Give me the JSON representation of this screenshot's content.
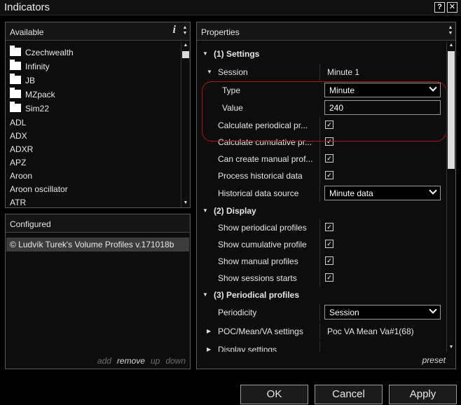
{
  "window": {
    "title": "Indicators",
    "help_button": "?",
    "close_button": "✕"
  },
  "available": {
    "title": "Available",
    "info_icon": "i",
    "folders": [
      "Czechwealth",
      "Infinity",
      "JB",
      "MZpack",
      "Sim22"
    ],
    "indicators": [
      "ADL",
      "ADX",
      "ADXR",
      "APZ",
      "Aroon",
      "Aroon oscillator",
      "ATR"
    ]
  },
  "configured": {
    "title": "Configured",
    "items": [
      "© Ludvík Turek's Volume Profiles v.171018b"
    ],
    "actions": {
      "add": "add",
      "remove": "remove",
      "up": "up",
      "down": "down"
    }
  },
  "properties": {
    "title": "Properties",
    "preset": "preset",
    "categories": {
      "settings": "(1) Settings",
      "display": "(2) Display",
      "periodical": "(3) Periodical profiles"
    },
    "session": {
      "label": "Session",
      "value": "Minute 1"
    },
    "type": {
      "label": "Type",
      "value": "Minute"
    },
    "value": {
      "label": "Value",
      "value": "240"
    },
    "calc_periodical": {
      "label": "Calculate periodical pr...",
      "checked": true
    },
    "calc_cumulative": {
      "label": "Calculate cumulative pr...",
      "checked": true
    },
    "manual_profiles": {
      "label": "Can create manual prof...",
      "checked": true
    },
    "process_historical": {
      "label": "Process historical data",
      "checked": true
    },
    "historical_source": {
      "label": "Historical data source",
      "value": "Minute data"
    },
    "show_periodical": {
      "label": "Show periodical profiles",
      "checked": true
    },
    "show_cumulative": {
      "label": "Show cumulative profile",
      "checked": true
    },
    "show_manual": {
      "label": "Show manual profiles",
      "checked": true
    },
    "show_sessions": {
      "label": "Show sessions starts",
      "checked": true
    },
    "periodicity": {
      "label": "Periodicity",
      "value": "Session"
    },
    "poc": {
      "label": "POC/Mean/VA settings",
      "value": "Poc VA Mean Va#1(68)"
    },
    "display_settings": {
      "label": "Display settings"
    }
  },
  "buttons": {
    "ok": "OK",
    "cancel": "Cancel",
    "apply": "Apply"
  },
  "colors": {
    "highlight": "#b01818",
    "background": "#000000",
    "panel_border": "#5a5a5a"
  },
  "icons": [
    "folder-icon",
    "info-icon",
    "checkbox-checked-icon",
    "expand-triangle-icon",
    "collapse-triangle-icon",
    "chevron-down-icon"
  ]
}
